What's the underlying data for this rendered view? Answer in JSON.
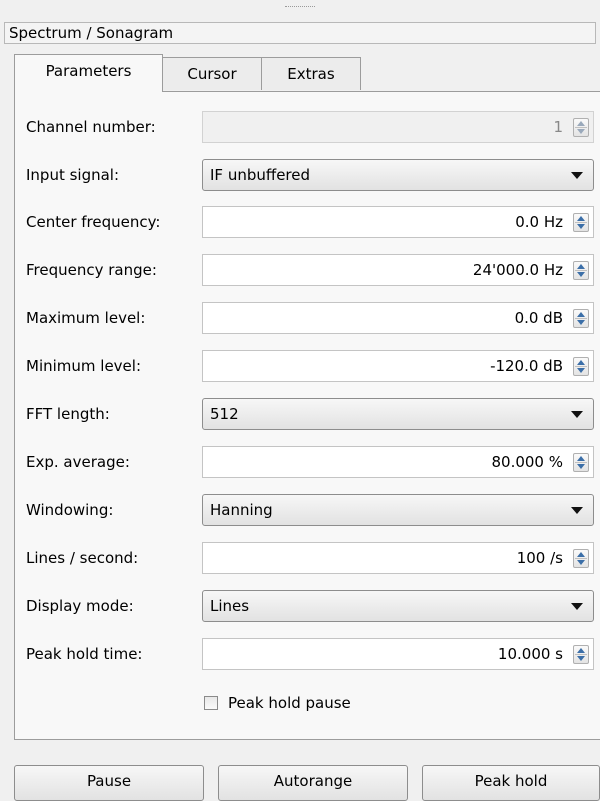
{
  "window": {
    "title": "Spectrum / Sonagram"
  },
  "tabs": [
    {
      "label": "Parameters",
      "active": true
    },
    {
      "label": "Cursor",
      "active": false
    },
    {
      "label": "Extras",
      "active": false
    }
  ],
  "parameters": {
    "channel_number": {
      "label": "Channel number:",
      "value": "1",
      "enabled": false
    },
    "input_signal": {
      "label": "Input signal:",
      "value": "IF unbuffered"
    },
    "center_frequency": {
      "label": "Center frequency:",
      "value": "0.0 Hz"
    },
    "frequency_range": {
      "label": "Frequency range:",
      "value": "24'000.0 Hz"
    },
    "maximum_level": {
      "label": "Maximum level:",
      "value": "0.0 dB"
    },
    "minimum_level": {
      "label": "Minimum level:",
      "value": "-120.0 dB"
    },
    "fft_length": {
      "label": "FFT length:",
      "value": "512"
    },
    "exp_average": {
      "label": "Exp. average:",
      "value": "80.000 %"
    },
    "windowing": {
      "label": "Windowing:",
      "value": "Hanning"
    },
    "lines_per_second": {
      "label": "Lines / second:",
      "value": "100 /s"
    },
    "display_mode": {
      "label": "Display mode:",
      "value": "Lines"
    },
    "peak_hold_time": {
      "label": "Peak hold time:",
      "value": "10.000 s"
    },
    "peak_hold_pause": {
      "label": "Peak hold pause",
      "checked": false
    }
  },
  "buttons": {
    "pause": "Pause",
    "autorange": "Autorange",
    "peak_hold": "Peak hold"
  },
  "icons": {
    "spin": "spin-updown-icon",
    "dropdown": "chevron-down-icon",
    "checkbox": "checkbox-unchecked-icon"
  },
  "colors": {
    "spin_arrow": "#3c6fa8",
    "background": "#f0f0f0",
    "panel": "#f8f8f8"
  }
}
